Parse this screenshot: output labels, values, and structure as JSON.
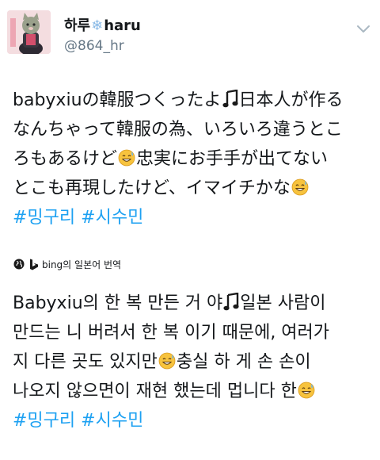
{
  "author": {
    "display_name": "하루",
    "snowflake": "❄",
    "display_name_latin": "haru",
    "handle": "@864_hr"
  },
  "tweet": {
    "lines": [
      "babyxiuの韓服つくったよ",
      "日本人が作る",
      "なんちゃって韓服の為、いろいろ違うとこ",
      "ろもあるけど",
      "忠実にお手手が出てない",
      "とこも再現したけど、イマイチかな"
    ],
    "hashtags": [
      "#밍구리",
      "#시수민"
    ]
  },
  "translation": {
    "label": "bing의 일본어 번역",
    "lines": [
      "Babyxiu의 한 복 만든 거 야",
      "일본 사람이",
      "만드는 니 버려서 한 복 이기 때문에, 여러가",
      "지 다른 곳도 있지만",
      "충실 하 게 손 손이",
      "나오지 않으면이 재현 했는데 멉니다 한"
    ],
    "hashtags": [
      "#밍구리",
      "#시수민"
    ]
  },
  "icons": {
    "chevron": "chevron-down-icon",
    "music": "music-note-icon",
    "emoji": "sweat-smile-emoji-icon",
    "globe": "globe-icon",
    "bing": "bing-logo-icon"
  },
  "colors": {
    "hashtag": "#1da1f2",
    "secondary": "#657786"
  }
}
